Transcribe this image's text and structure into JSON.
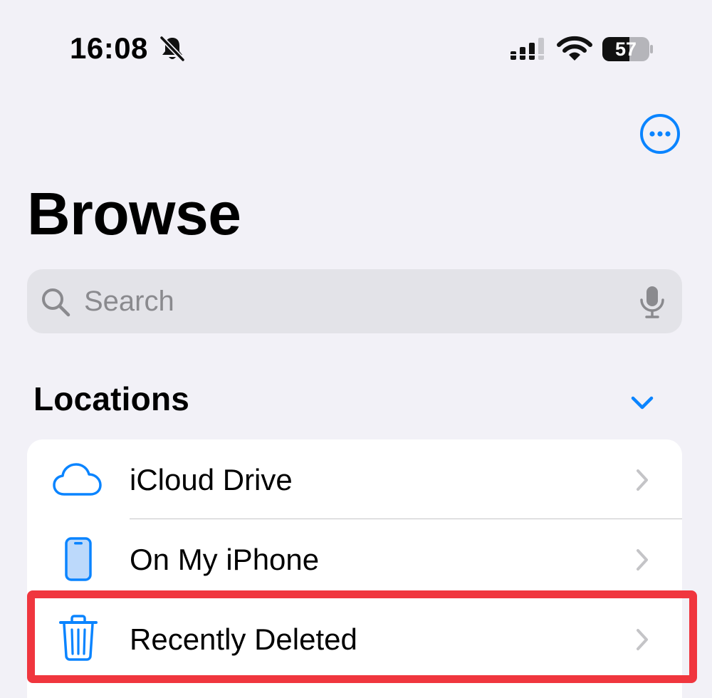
{
  "status_bar": {
    "time": "16:08",
    "battery_level": "57",
    "icons": [
      "bell-slash-icon",
      "cellular-signal-icon",
      "wifi-icon",
      "battery-icon"
    ]
  },
  "nav": {
    "more_icon": "ellipsis-circle-icon"
  },
  "page": {
    "title": "Browse"
  },
  "search": {
    "placeholder": "Search",
    "value": ""
  },
  "locations": {
    "title": "Locations",
    "items": [
      {
        "label": "iCloud Drive",
        "icon": "cloud-icon"
      },
      {
        "label": "On My iPhone",
        "icon": "iphone-icon"
      },
      {
        "label": "Recently Deleted",
        "icon": "trash-icon"
      }
    ]
  },
  "colors": {
    "accent": "#0a84ff",
    "background": "#f2f1f7",
    "highlight": "#f0363e"
  }
}
